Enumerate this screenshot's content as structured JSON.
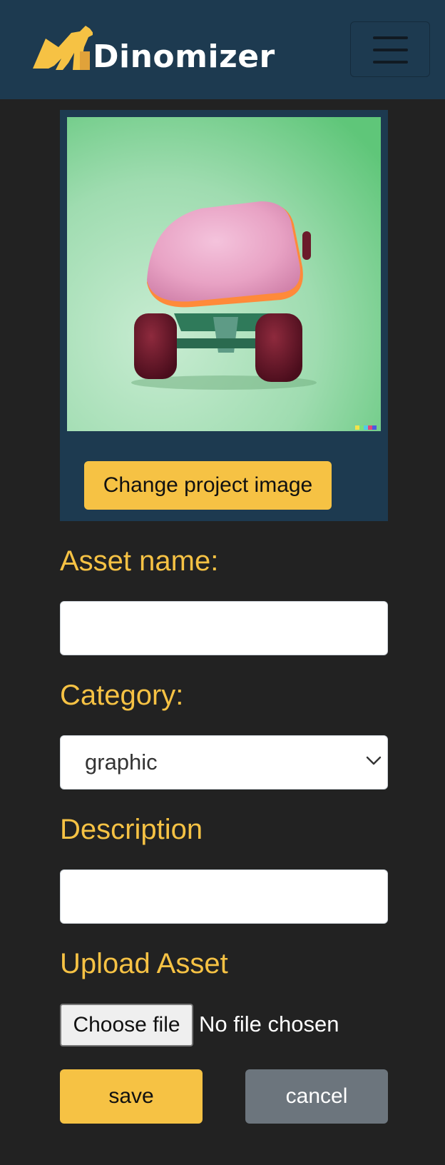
{
  "navbar": {
    "brand": "Dinomizer",
    "logo_icon": "dinosaur-logo-icon",
    "menu_icon": "hamburger-menu-icon"
  },
  "project_image": {
    "alt": "pink fluffy skateboard on green background",
    "change_label": "Change project image"
  },
  "form": {
    "asset_name_label": "Asset name:",
    "asset_name_value": "",
    "category_label": "Category:",
    "category_selected": "graphic",
    "description_label": "Description",
    "description_value": "",
    "upload_label": "Upload Asset",
    "choose_file_label": "Choose file",
    "file_status": "No file chosen"
  },
  "actions": {
    "save_label": "save",
    "cancel_label": "cancel"
  },
  "colors": {
    "navbar_bg": "#1d3a50",
    "page_bg": "#222222",
    "accent": "#f6c244",
    "secondary": "#6c757d"
  }
}
